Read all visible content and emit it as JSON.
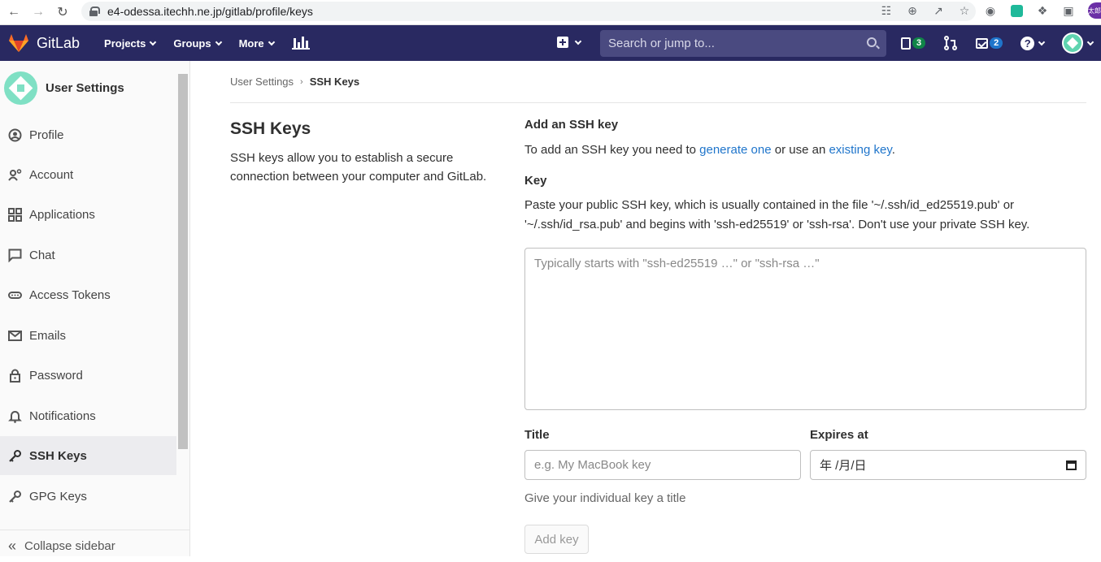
{
  "browser": {
    "url": "e4-odessa.itechh.ne.jp/gitlab/profile/keys",
    "profile_label": "太郎"
  },
  "header": {
    "brand": "GitLab",
    "nav": [
      "Projects",
      "Groups",
      "More"
    ],
    "search_placeholder": "Search or jump to...",
    "issues_count": "3",
    "todos_count": "2",
    "help_glyph": "?",
    "colors": {
      "header_bg": "#292961",
      "search_bg": "#4a4a80",
      "badge_green": "#108548",
      "badge_blue": "#1f75cb"
    }
  },
  "sidebar": {
    "title": "User Settings",
    "items": [
      {
        "label": "Profile",
        "icon": "profile-icon"
      },
      {
        "label": "Account",
        "icon": "account-icon"
      },
      {
        "label": "Applications",
        "icon": "applications-icon"
      },
      {
        "label": "Chat",
        "icon": "chat-icon"
      },
      {
        "label": "Access Tokens",
        "icon": "token-icon"
      },
      {
        "label": "Emails",
        "icon": "mail-icon"
      },
      {
        "label": "Password",
        "icon": "lock-icon"
      },
      {
        "label": "Notifications",
        "icon": "bell-icon"
      },
      {
        "label": "SSH Keys",
        "icon": "key-icon",
        "active": true
      },
      {
        "label": "GPG Keys",
        "icon": "key-icon"
      }
    ],
    "collapse": "Collapse sidebar"
  },
  "breadcrumb": {
    "parent": "User Settings",
    "current": "SSH Keys"
  },
  "left": {
    "title": "SSH Keys",
    "description": "SSH keys allow you to establish a secure connection between your computer and GitLab."
  },
  "form": {
    "heading": "Add an SSH key",
    "intro_prefix": "To add an SSH key you need to ",
    "intro_link1": "generate one",
    "intro_middle": " or use an ",
    "intro_link2": "existing key",
    "intro_suffix": ".",
    "key_label": "Key",
    "key_help": "Paste your public SSH key, which is usually contained in the file '~/.ssh/id_ed25519.pub' or '~/.ssh/id_rsa.pub' and begins with 'ssh-ed25519' or 'ssh-rsa'. Don't use your private SSH key.",
    "key_placeholder": "Typically starts with \"ssh-ed25519 …\" or \"ssh-rsa …\"",
    "title_label": "Title",
    "title_placeholder": "e.g. My MacBook key",
    "title_hint": "Give your individual key a title",
    "expires_label": "Expires at",
    "expires_value": "年 /月/日",
    "submit": "Add key"
  }
}
